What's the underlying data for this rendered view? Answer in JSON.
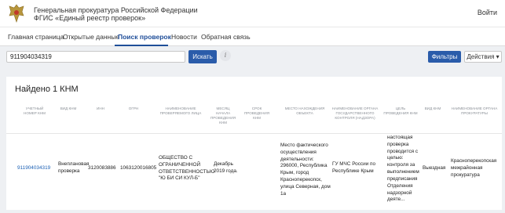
{
  "header": {
    "org_line1": "Генеральная прокуратура Российской Федерации",
    "org_line2": "ФГИС «Единый реестр проверок»",
    "login": "Войти",
    "emblem_icon": "coat-of-arms-icon"
  },
  "nav": {
    "tabs": [
      {
        "label": "Главная страница"
      },
      {
        "label": "Открытые данные"
      },
      {
        "label": "Поиск проверок"
      },
      {
        "label": "Новости"
      },
      {
        "label": "Обратная связь"
      }
    ],
    "active": "Поиск проверок"
  },
  "search": {
    "value": "911904034319",
    "button": "Искать",
    "info_icon": "i"
  },
  "toolbar": {
    "filters": "Фильтры",
    "actions": "Действия ▾"
  },
  "results": {
    "title": "Найдено 1 КНМ",
    "columns": [
      "Учетный номер КНМ",
      "Вид КНМ",
      "ИНН",
      "ОГРН",
      "Наименование проверяемого лица",
      "Месяц начала проведения КНМ",
      "Срок проведения КНМ",
      "Место нахождения объекта",
      "Наименование органа государственного контроля (надзора)",
      "Цель проведения КНМ",
      "Вид КНМ",
      "Наименование органа прокуратуры"
    ],
    "row": {
      "number": "911904034319",
      "kind": "Внеплановая проверка",
      "inn": "3120083886",
      "ogrn": "1063120016805",
      "name": "ОБЩЕСТВО С ОГРАНИЧЕННОЙ ОТВЕТСТВЕННОСТЬЮ \"Ю БИ СИ КУЛ-Б\"",
      "month": "Декабрь 2019 года.",
      "duration": "",
      "location": "Место фактического осуществления деятельности: 296000, Республика Крым, город Красноперекопск, улица Северная, дом 1а",
      "authority": "ГУ МЧС России по Республике Крым",
      "goal": "настоящая проверка проводится с целью: контроля за выполнением предписания Отделения надзорной деяте...",
      "form": "Выездная",
      "prosecutor": "Красноперекопская межрайонная прокуратура"
    }
  },
  "colors": {
    "accent": "#2a5caa",
    "active_tab": "#1f4e99",
    "link": "#1a5fb4",
    "background": "#eef0f3"
  }
}
